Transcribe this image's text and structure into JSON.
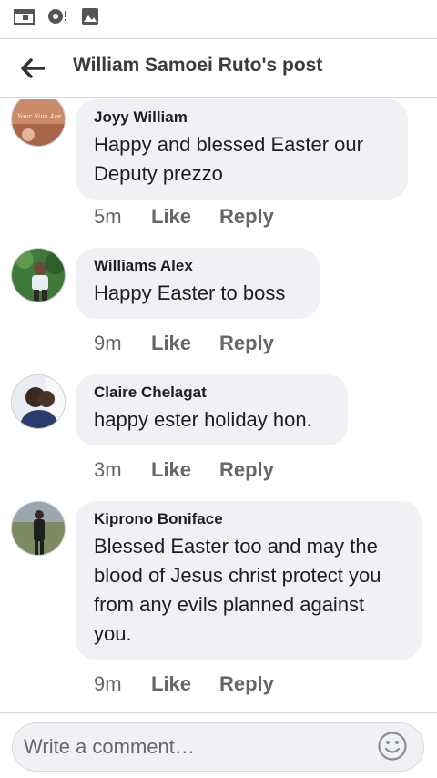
{
  "status_bar": {
    "icons": [
      "calendar-icon",
      "camera-notification-icon",
      "image-icon"
    ]
  },
  "header": {
    "back_icon": "arrow-left-icon",
    "title": "William Samoei Ruto's post"
  },
  "comments": [
    {
      "author": "Joyy William",
      "text": " Happy and blessed Easter our Deputy prezzo",
      "time": "5m",
      "like_label": "Like",
      "reply_label": "Reply",
      "avatar_caption": "Your Sins Are"
    },
    {
      "author": "Williams Alex",
      "text": "Happy Easter to boss",
      "time": "9m",
      "like_label": "Like",
      "reply_label": "Reply"
    },
    {
      "author": "Claire Chelagat",
      "text": "happy ester holiday hon.",
      "time": "3m",
      "like_label": "Like",
      "reply_label": "Reply"
    },
    {
      "author": "Kiprono Boniface",
      "text": "Blessed Easter too and may the blood of Jesus christ protect you from any evils planned against you.",
      "time": "9m",
      "like_label": "Like",
      "reply_label": "Reply"
    }
  ],
  "composer": {
    "placeholder": "Write a comment…",
    "emoji_icon": "smiley-icon"
  },
  "colors": {
    "bubble": "#f0f1f4",
    "meta_text": "#65676b",
    "body_text": "#1c1e21"
  }
}
